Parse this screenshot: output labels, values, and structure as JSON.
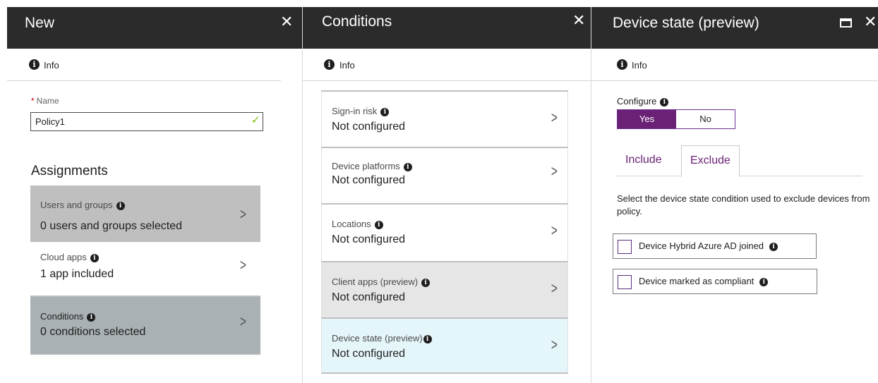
{
  "blade_new": {
    "title": "New",
    "close_icon": "close-icon",
    "info_label": "Info",
    "name_label": "Name",
    "name_required": "*",
    "name_value": "Policy1",
    "assignments_title": "Assignments",
    "items": [
      {
        "label": "Users and groups",
        "value": "0 users and groups selected"
      },
      {
        "label": "Cloud apps",
        "value": "1 app included"
      },
      {
        "label": "Conditions",
        "value": "0  conditions  selected"
      }
    ]
  },
  "blade_conditions": {
    "title": "Conditions",
    "info_label": "Info",
    "items": [
      {
        "label": "Sign-in risk",
        "value": "Not configured"
      },
      {
        "label": "Device platforms",
        "value": "Not configured"
      },
      {
        "label": "Locations",
        "value": "Not configured"
      },
      {
        "label": "Client apps (preview)",
        "value": "Not configured"
      },
      {
        "label": "Device state (preview)",
        "value": "Not configured"
      }
    ]
  },
  "blade_device": {
    "title": "Device state (preview)",
    "info_label": "Info",
    "configure_label": "Configure",
    "toggle_yes": "Yes",
    "toggle_no": "No",
    "tab_include": "Include",
    "tab_exclude": "Exclude",
    "description": "Select the device state condition used to exclude devices from policy.",
    "options": [
      {
        "label": "Device Hybrid Azure AD joined"
      },
      {
        "label": "Device marked as compliant"
      }
    ]
  },
  "colors": {
    "header_bg": "#2b2b2b",
    "accent_purple": "#6b2176",
    "selected_item_bg": "#bfbfbf",
    "active_condition_bg": "#e5f6fb",
    "check_green": "#7ab800"
  }
}
